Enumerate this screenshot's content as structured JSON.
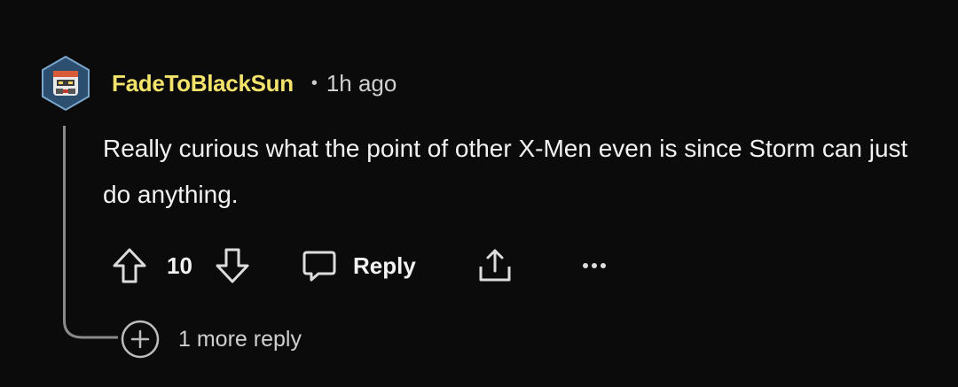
{
  "comment": {
    "author": "FadeToBlackSun",
    "separator": "•",
    "time_ago": "1h ago",
    "text": "Really curious what the point of other X-Men even is since Storm can just do anything.",
    "score": "10",
    "reply_label": "Reply",
    "more_replies_label": "1 more reply"
  },
  "icons": {
    "avatar": "avatar-icon",
    "upvote": "upvote-arrow-icon",
    "downvote": "downvote-arrow-icon",
    "reply": "speech-bubble-icon",
    "share": "share-icon",
    "more": "more-dots-icon",
    "expand": "plus-circle-icon"
  },
  "colors": {
    "background": "#0b0b0b",
    "username": "#f3e36b",
    "text": "#f2f2f2",
    "muted": "#cfcfcf",
    "thread_line": "#8a8a8a"
  }
}
